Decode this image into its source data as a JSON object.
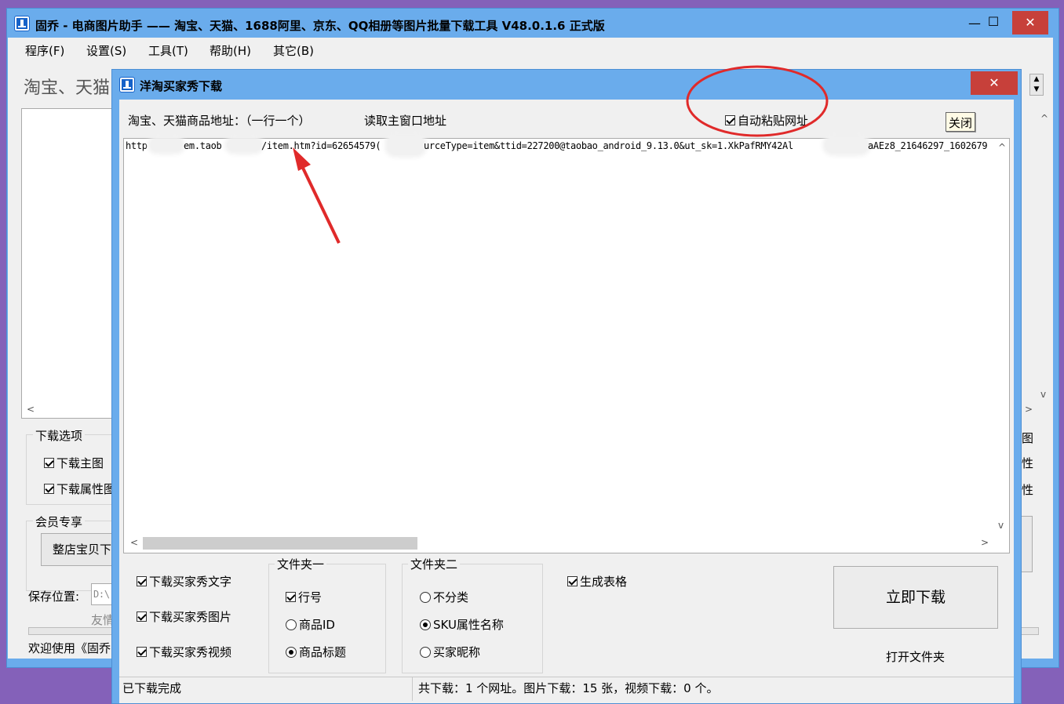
{
  "main_window": {
    "title": "固乔 - 电商图片助手 —— 淘宝、天猫、1688阿里、京东、QQ相册等图片批量下载工具 V48.0.1.6 正式版",
    "minimize": "—",
    "maximize": "☐",
    "close": "✕",
    "menu": [
      "程序(F)",
      "设置(S)",
      "工具(T)",
      "帮助(H)",
      "其它(B)"
    ],
    "header_partial": "淘宝、天猫",
    "download_options_label": "下载选项",
    "cb_main_image": "下载主图",
    "cb_attr_image": "下载属性图",
    "member_label": "会员专享",
    "shop_button": "整店宝贝下",
    "save_label": "保存位置:",
    "save_path": "D:\\",
    "friend_link": "友情",
    "welcome": "欢迎使用《固乔",
    "right_frag_1": "图",
    "right_frag_2": "性",
    "right_frag_3": "性"
  },
  "dialog": {
    "title": "洋淘买家秀下载",
    "close": "✕",
    "address_label": "淘宝、天猫商品地址：（一行一个）",
    "read_main_link": "读取主窗口地址",
    "auto_paste": "自动粘贴网址",
    "auto_paste_checked": true,
    "close_button": "关闭",
    "url_segments": [
      "http",
      "em.taob",
      "/item.htm?id=62654579(",
      "urceType=item&ttid=227200@taobao_android_9.13.0&ut_sk=1.XkPafRMY42Al",
      "aAEz8_21646297_1602679"
    ],
    "options": [
      {
        "label": "下载买家秀文字",
        "checked": true
      },
      {
        "label": "下载买家秀图片",
        "checked": true
      },
      {
        "label": "下载买家秀视频",
        "checked": true
      }
    ],
    "folder1": {
      "label": "文件夹一",
      "items": [
        {
          "label": "行号",
          "type": "checkbox",
          "checked": true
        },
        {
          "label": "商品ID",
          "type": "radio",
          "checked": false
        },
        {
          "label": "商品标题",
          "type": "radio",
          "checked": true
        }
      ]
    },
    "folder2": {
      "label": "文件夹二",
      "items": [
        {
          "label": "不分类",
          "checked": false
        },
        {
          "label": "SKU属性名称",
          "checked": true
        },
        {
          "label": "买家昵称",
          "checked": false
        }
      ]
    },
    "gen_table": "生成表格",
    "gen_table_checked": true,
    "download_now": "立即下载",
    "open_folder": "打开文件夹",
    "status_left": "已下载完成",
    "status_right": "共下载：1 个网址。图片下载：15 张，视频下载：0 个。"
  },
  "annotation_colors": {
    "circle": "#e02a2a",
    "arrow": "#e02a2a"
  }
}
